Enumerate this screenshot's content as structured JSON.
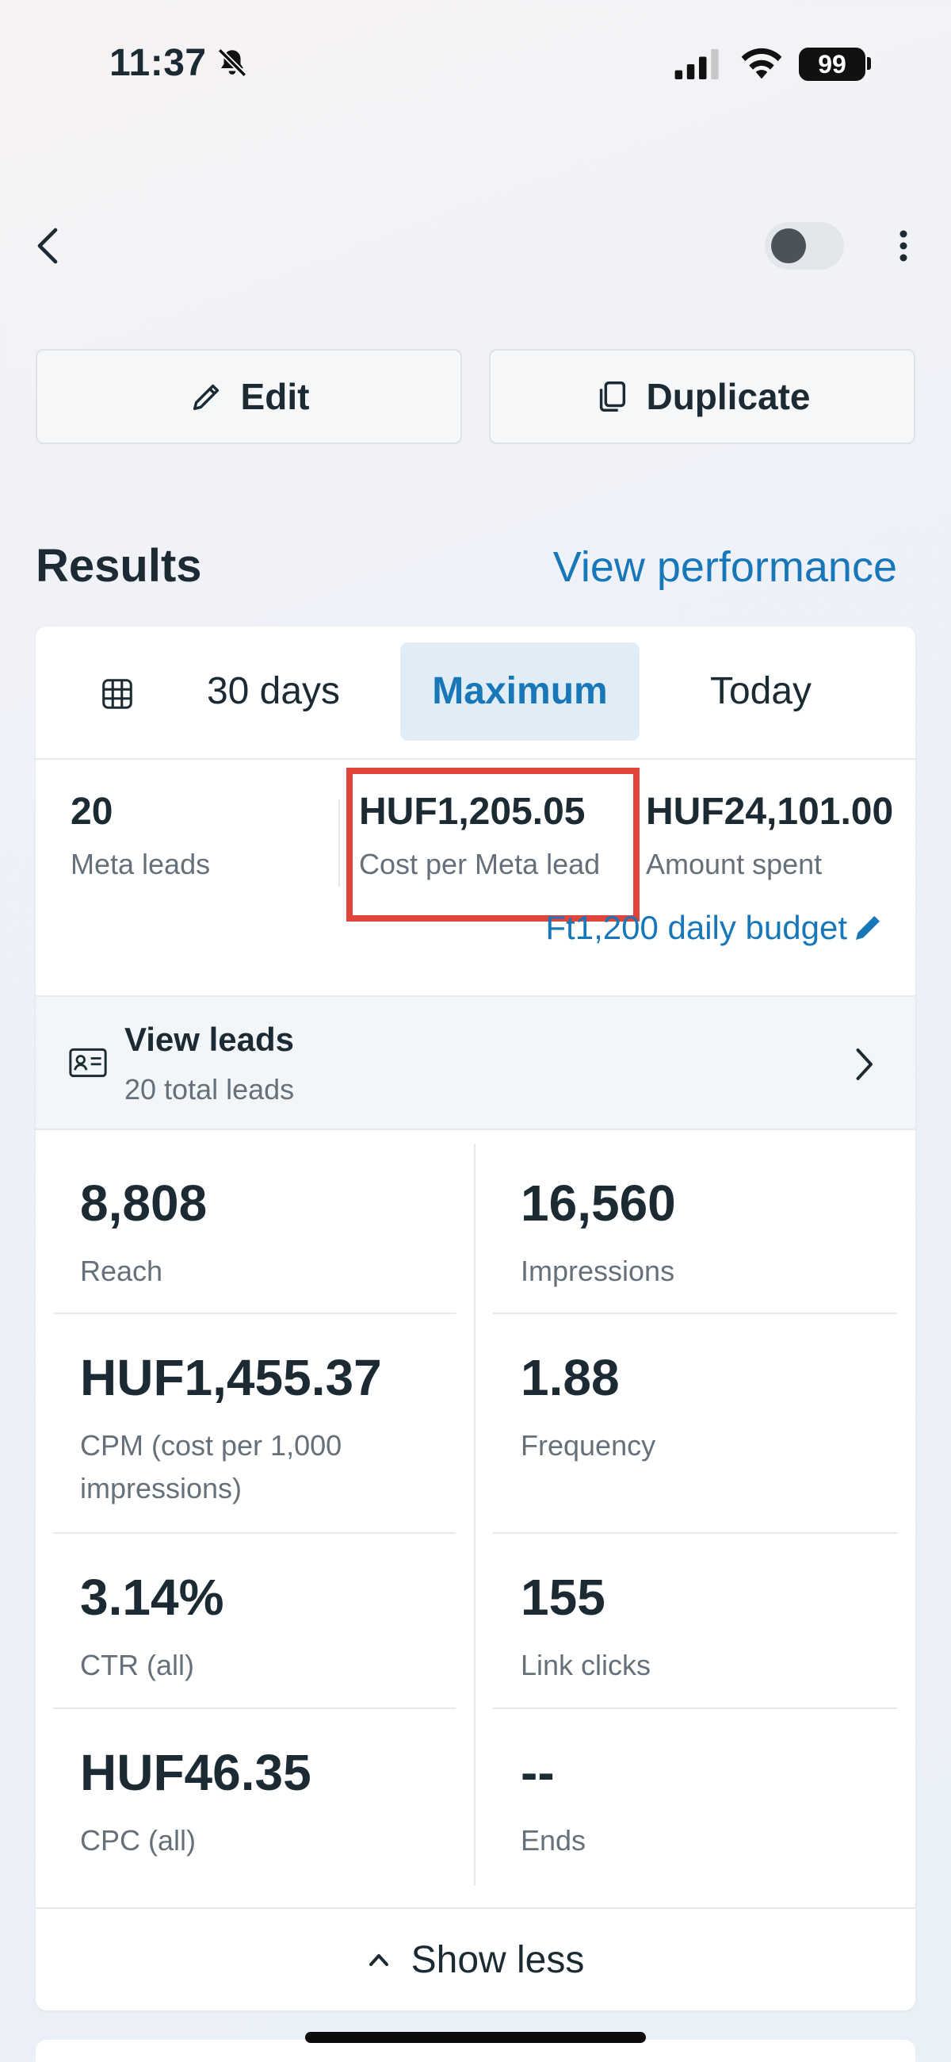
{
  "status_bar": {
    "time": "11:37",
    "battery": "99"
  },
  "actions": {
    "edit_label": "Edit",
    "duplicate_label": "Duplicate"
  },
  "results": {
    "title": "Results",
    "view_performance": "View performance"
  },
  "tabs": [
    {
      "label": "30 days"
    },
    {
      "label": "Maximum",
      "selected": true
    },
    {
      "label": "Today"
    }
  ],
  "summary": [
    {
      "value": "20",
      "label": "Meta leads"
    },
    {
      "value": "HUF1,205.05",
      "label": "Cost per Meta lead"
    },
    {
      "value": "HUF24,101.00",
      "label": "Amount spent"
    }
  ],
  "budget": "Ft1,200 daily budget",
  "leads": {
    "title": "View leads",
    "subtitle": "20 total leads"
  },
  "metrics": [
    {
      "value": "8,808",
      "label": "Reach"
    },
    {
      "value": "16,560",
      "label": "Impressions"
    },
    {
      "value": "HUF1,455.37",
      "label": "CPM (cost per 1,000 impressions)"
    },
    {
      "value": "1.88",
      "label": "Frequency"
    },
    {
      "value": "3.14%",
      "label": "CTR (all)"
    },
    {
      "value": "155",
      "label": "Link clicks"
    },
    {
      "value": "HUF46.35",
      "label": "CPC (all)"
    },
    {
      "value": "--",
      "label": "Ends"
    }
  ],
  "show_less": "Show less",
  "colors": {
    "accent": "#1877b8",
    "highlight": "#e0443a",
    "text": "#1c2b33",
    "muted": "#65707a"
  }
}
